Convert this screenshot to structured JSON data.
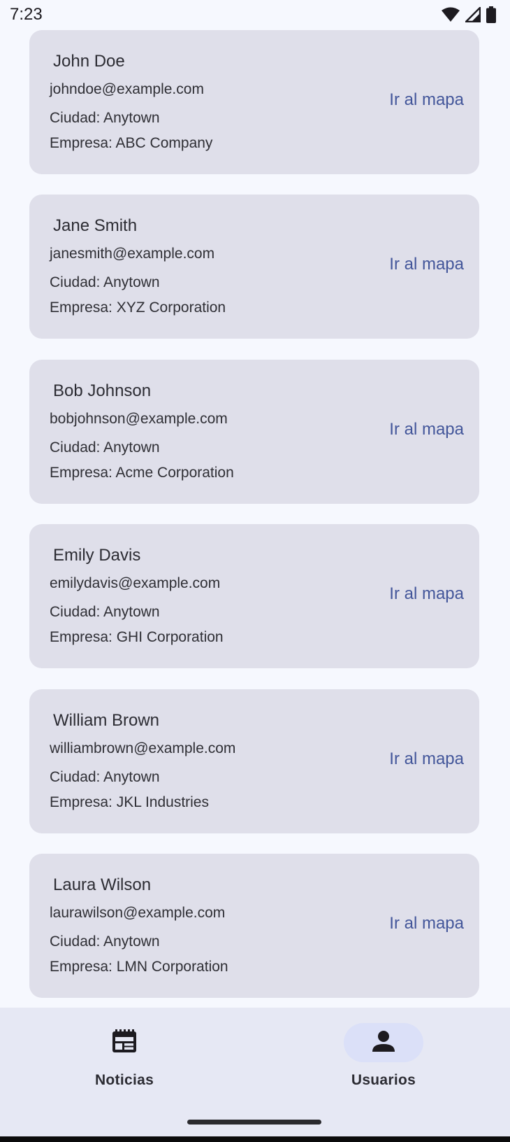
{
  "status_bar": {
    "time": "7:23"
  },
  "users": [
    {
      "name": "John Doe",
      "email": "johndoe@example.com",
      "city": "Ciudad: Anytown",
      "company": "Empresa: ABC Company",
      "action": "Ir al mapa"
    },
    {
      "name": "Jane Smith",
      "email": "janesmith@example.com",
      "city": "Ciudad: Anytown",
      "company": "Empresa: XYZ Corporation",
      "action": "Ir al mapa"
    },
    {
      "name": "Bob Johnson",
      "email": "bobjohnson@example.com",
      "city": "Ciudad: Anytown",
      "company": "Empresa: Acme Corporation",
      "action": "Ir al mapa"
    },
    {
      "name": "Emily Davis",
      "email": "emilydavis@example.com",
      "city": "Ciudad: Anytown",
      "company": "Empresa: GHI Corporation",
      "action": "Ir al mapa"
    },
    {
      "name": "William Brown",
      "email": "williambrown@example.com",
      "city": "Ciudad: Anytown",
      "company": "Empresa: JKL Industries",
      "action": "Ir al mapa"
    },
    {
      "name": "Laura Wilson",
      "email": "laurawilson@example.com",
      "city": "Ciudad: Anytown",
      "company": "Empresa: LMN Corporation",
      "action": "Ir al mapa"
    }
  ],
  "bottom_nav": {
    "items": [
      {
        "label": "Noticias",
        "icon": "newspaper-icon",
        "active": false
      },
      {
        "label": "Usuarios",
        "icon": "person-icon",
        "active": true
      }
    ]
  },
  "colors": {
    "background": "#f6f8fe",
    "card": "#dfdfea",
    "accent": "#43569a",
    "nav_background": "#e6e8f4",
    "nav_active_pill": "#dbe0f8"
  }
}
